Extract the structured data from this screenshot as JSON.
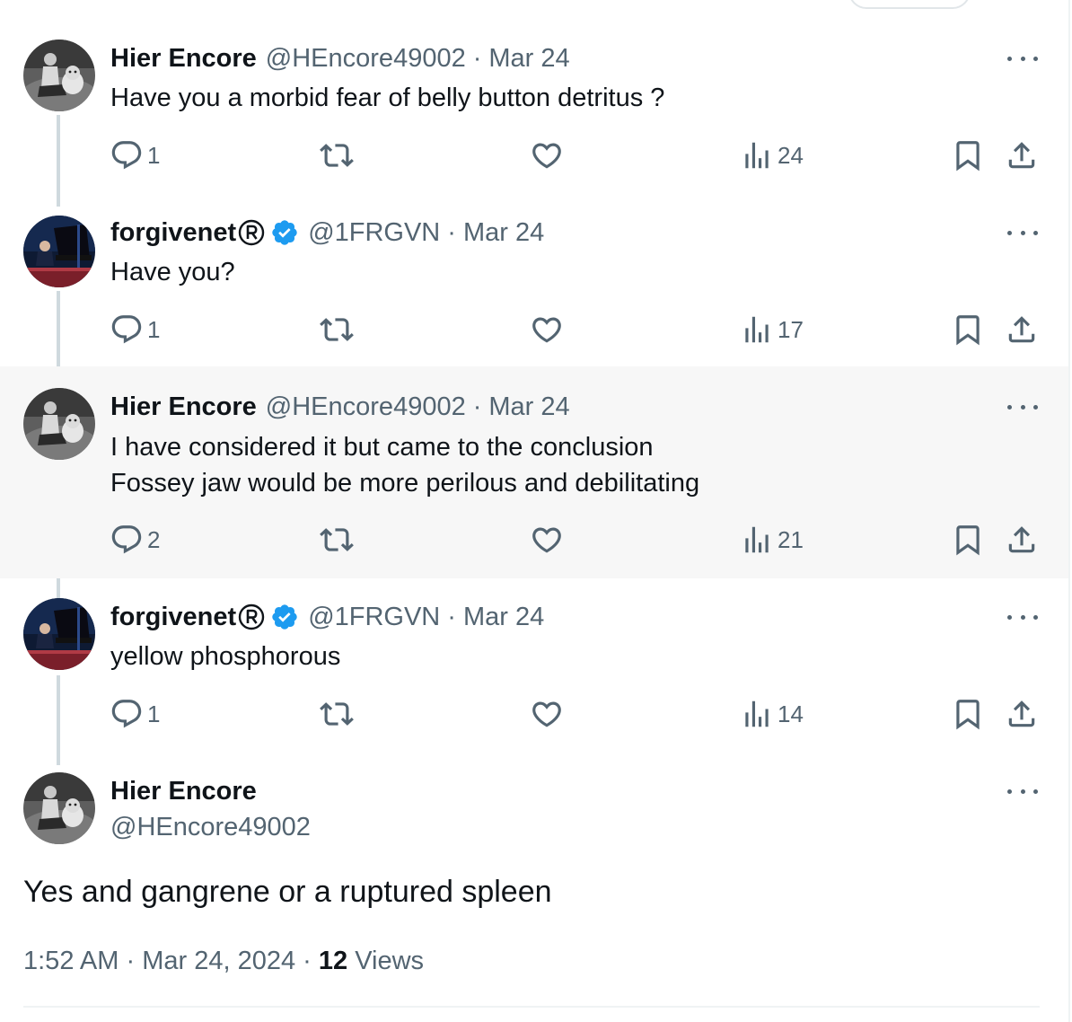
{
  "tweets": [
    {
      "name": "Hier Encore",
      "handle": "@HEncore49002",
      "date": "Mar 24",
      "text": "Have you a morbid fear of belly button detritus ?",
      "replies": "1",
      "views": "24",
      "avatar": "man-with-bulldog",
      "verified": false,
      "registered": false
    },
    {
      "name": "forgivenet",
      "handle": "@1FRGVN",
      "date": "Mar 24",
      "text": "Have you?",
      "replies": "1",
      "views": "17",
      "avatar": "pianist-on-stage",
      "verified": true,
      "registered": true
    },
    {
      "name": "Hier Encore",
      "handle": "@HEncore49002",
      "date": "Mar 24",
      "text": "I have considered it but came to the conclusion\nFossey jaw would be more perilous and debilitating",
      "replies": "2",
      "views": "21",
      "avatar": "man-with-bulldog",
      "verified": false,
      "registered": false
    },
    {
      "name": "forgivenet",
      "handle": "@1FRGVN",
      "date": "Mar 24",
      "text": "yellow phosphorous",
      "replies": "1",
      "views": "14",
      "avatar": "pianist-on-stage",
      "verified": true,
      "registered": true
    }
  ],
  "main_tweet": {
    "name": "Hier Encore",
    "handle": "@HEncore49002",
    "text": "Yes and gangrene or a ruptured spleen",
    "time": "1:52 AM",
    "date": "Mar 24, 2024",
    "views_count": "12",
    "views_label": "Views",
    "separator": "·",
    "avatar": "man-with-bulldog"
  },
  "colors": {
    "text_primary": "#0f1419",
    "text_secondary": "#536471",
    "verified_badge": "#1d9bf0",
    "thread_line": "#cfd9de",
    "highlight_background": "#f7f7f7"
  }
}
